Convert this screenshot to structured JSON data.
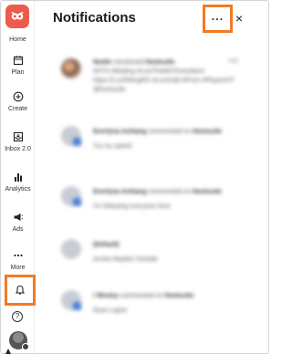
{
  "sidebar": {
    "items": [
      {
        "label": "Home",
        "icon": "home-icon"
      },
      {
        "label": "Plan",
        "icon": "calendar-icon"
      },
      {
        "label": "Create",
        "icon": "plus-circle-icon"
      },
      {
        "label": "Inbox 2.0",
        "icon": "inbox-icon"
      },
      {
        "label": "Analytics",
        "icon": "bar-chart-icon"
      },
      {
        "label": "Ads",
        "icon": "megaphone-icon"
      },
      {
        "label": "More",
        "icon": "dots-icon"
      }
    ],
    "notifications_icon": "bell-icon",
    "help_icon": "help-icon",
    "help_glyph": "?"
  },
  "header": {
    "title": "Notifications",
    "more_glyph": "···",
    "close_glyph": "×"
  },
  "colors": {
    "brand": "#ef5b4b",
    "highlight": "#f07a24",
    "badge": "#4a7fd6"
  },
  "notifications": [
    {
      "actor": "Nealic",
      "action": "mentioned",
      "target": "Hootsuite",
      "body": "WITH #Mailing #LiveTheMOTimesbiere https://t.co/RMvgRG #Loremild #Pmm #PlayerHIT @hootsuite",
      "time": "Sep",
      "avatar": "photo"
    },
    {
      "actor": "Everlyna Ashiang",
      "action": "commented on",
      "target": "Hootsuite",
      "body": "Try my speed",
      "time": "",
      "avatar": "placeholder"
    },
    {
      "actor": "Everlyna Ashiang",
      "action": "commented on",
      "target": "Hootsuite",
      "body": "I'm following everyone here",
      "time": "",
      "avatar": "placeholder"
    },
    {
      "actor": "(Default)",
      "action": "",
      "target": "",
      "body": "Archie Mayfair Outside",
      "time": "",
      "avatar": "placeholder"
    },
    {
      "actor": "I Wesley",
      "action": "commented on",
      "target": "Hootsuite",
      "body": "Ryan Lajoie",
      "time": "",
      "avatar": "placeholder"
    }
  ]
}
